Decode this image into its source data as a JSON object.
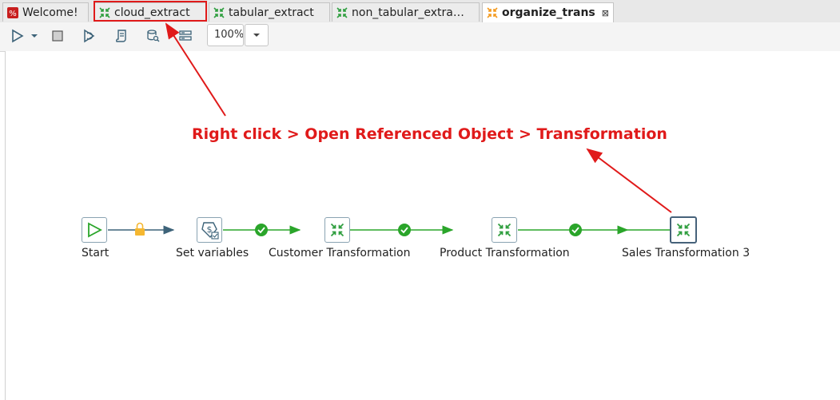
{
  "tabs": [
    {
      "label": "Welcome!",
      "icon": "pentaho-logo-icon",
      "active": false
    },
    {
      "label": "cloud_extract",
      "icon": "transformation-icon",
      "active": false,
      "highlighted": true
    },
    {
      "label": "tabular_extract",
      "icon": "transformation-icon",
      "active": false
    },
    {
      "label": "non_tabular_extra…",
      "icon": "transformation-icon",
      "active": false
    },
    {
      "label": "organize_trans",
      "icon": "job-icon",
      "active": true,
      "close": "⊠"
    }
  ],
  "toolbar": {
    "buttons": [
      "run-icon",
      "run-dropdown-icon",
      "stop-icon",
      "replay-icon",
      "preview-icon",
      "sql-icon",
      "explore-db-icon",
      "layout-icon"
    ],
    "zoom_value": "100%"
  },
  "annotation": {
    "text": "Right click > Open Referenced Object > Transformation",
    "color": "#e01a1a"
  },
  "workflow": {
    "nodes": [
      {
        "label": "Start",
        "icon": "start-icon"
      },
      {
        "label": "Set variables",
        "icon": "set-variables-icon"
      },
      {
        "label": "Customer Transformation",
        "icon": "transformation-icon"
      },
      {
        "label": "Product Transformation",
        "icon": "transformation-icon"
      },
      {
        "label": "Sales Transformation 3",
        "icon": "transformation-icon",
        "selected": true
      }
    ],
    "hops": [
      {
        "from": "Start",
        "to": "Set variables",
        "status": "unconditional-lock-icon",
        "color": "#3d6379"
      },
      {
        "from": "Set variables",
        "to": "Customer Transformation",
        "status": "success-check-icon",
        "color": "#2aa52a"
      },
      {
        "from": "Customer Transformation",
        "to": "Product Transformation",
        "status": "success-check-icon",
        "color": "#2aa52a"
      },
      {
        "from": "Product Transformation",
        "to": "Sales Transformation 3",
        "status": "success-check-icon",
        "color": "#2aa52a"
      }
    ]
  },
  "colors": {
    "accent_red": "#e01a1a",
    "hop_green": "#2aa52a",
    "hop_blue": "#3d6379",
    "transform_green": "#2e9e3e"
  }
}
